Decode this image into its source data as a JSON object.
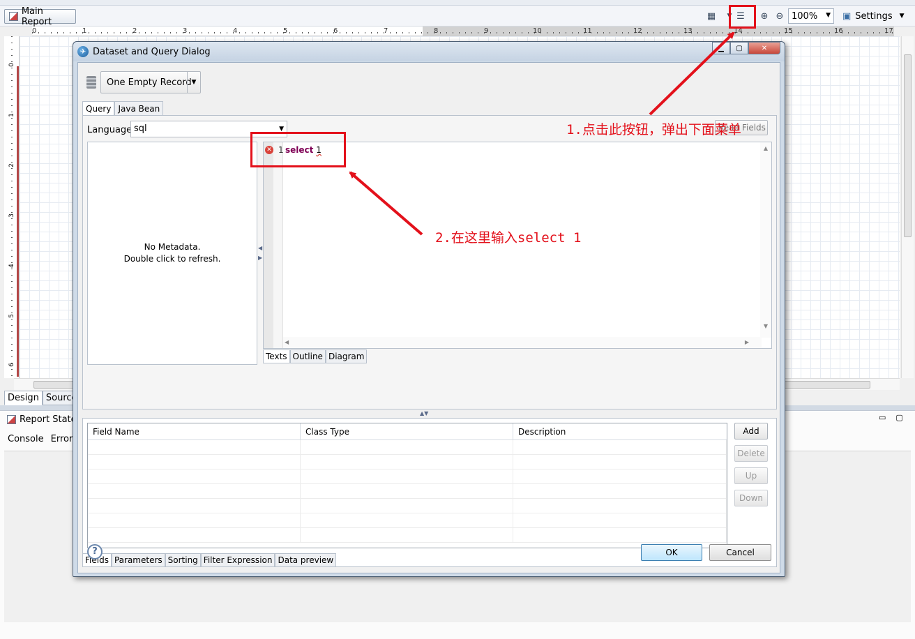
{
  "editor": {
    "main_report_tab": "Main Report",
    "zoom": "100%",
    "settings_label": "Settings",
    "ruler_numbers": [
      "0",
      "1",
      "2",
      "3",
      "4",
      "5",
      "6",
      "7",
      "8",
      "9",
      "10",
      "11",
      "12",
      "13",
      "14",
      "15",
      "16",
      "17"
    ],
    "left_ruler_numbers": [
      "0",
      "1",
      "2",
      "3",
      "4",
      "5",
      "6"
    ],
    "bottom_tabs": [
      "Design",
      "Source"
    ],
    "report_state_title": "Report State",
    "console_tabs": [
      "Console",
      "Errors"
    ]
  },
  "dialog": {
    "title": "Dataset and Query Dialog",
    "datasource": "One Empty Record",
    "query_tabs": [
      "Query",
      "Java Bean"
    ],
    "language_label": "Language",
    "language_value": "sql",
    "read_fields_label": "Read Fields",
    "metadata_line1": "No Metadata.",
    "metadata_line2": "Double click to refresh.",
    "sql_line_number": "1",
    "sql_keyword": "select",
    "sql_value": "1",
    "editor_tabs": [
      "Texts",
      "Outline",
      "Diagram"
    ],
    "fields_columns": [
      "Field Name",
      "Class Type",
      "Description"
    ],
    "buttons": {
      "add": "Add",
      "delete": "Delete",
      "up": "Up",
      "down": "Down"
    },
    "fields_tabs": [
      "Fields",
      "Parameters",
      "Sorting",
      "Filter Expression",
      "Data preview"
    ],
    "help": "?",
    "ok": "OK",
    "cancel": "Cancel"
  },
  "annotations": {
    "step1": "1.点击此按钮，弹出下面菜单",
    "step2": "2.在这里输入select 1",
    "color": "#e3111b"
  }
}
